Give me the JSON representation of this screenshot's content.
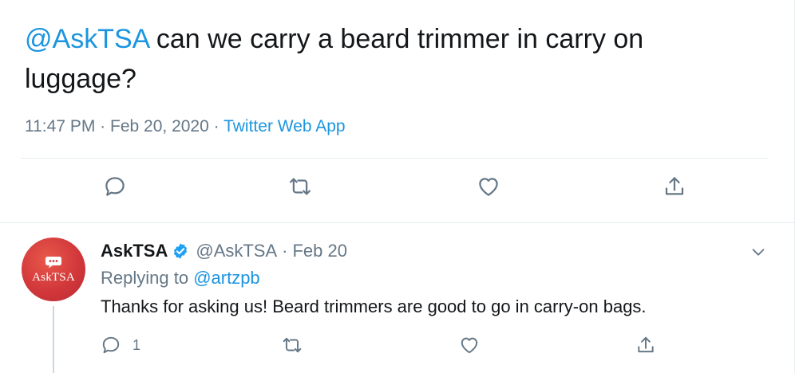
{
  "tweet": {
    "mention": "@AskTSA",
    "text": " can we carry a beard trimmer in carry on luggage?",
    "time": "11:47 PM",
    "date": "Feb 20, 2020",
    "separator": "·",
    "source": "Twitter Web App"
  },
  "reply": {
    "avatar_text": "AskTSA",
    "name": "AskTSA",
    "handle": "@AskTSA",
    "dot": "·",
    "date": "Feb 20",
    "replying_prefix": "Replying to ",
    "replying_to": "@artzpb",
    "text": "Thanks for asking us! Beard trimmers are good to go in carry-on bags.",
    "reply_count": "1"
  },
  "colors": {
    "link": "#1b95e0",
    "muted": "#657786",
    "icon": "#657786",
    "avatar": "#d2383b",
    "verified": "#1da1f2"
  },
  "icons": {
    "reply": "reply-icon",
    "retweet": "retweet-icon",
    "like": "heart-icon",
    "share": "share-icon",
    "verified": "verified-badge-icon",
    "more": "chevron-down-icon"
  }
}
